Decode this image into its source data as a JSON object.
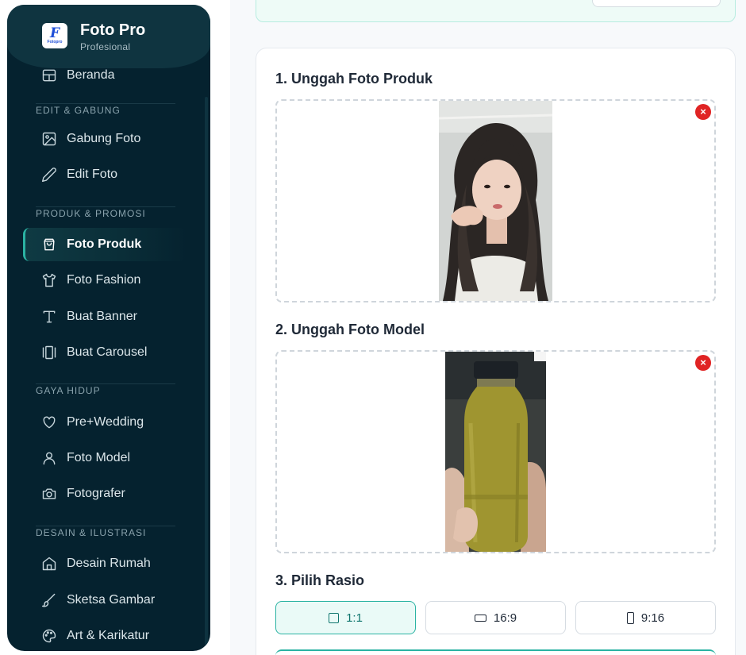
{
  "brand": {
    "title": "Foto Pro",
    "subtitle": "Profesional",
    "logo_letter": "F",
    "logo_text": "Fotopro"
  },
  "sidebar": {
    "partial_item": "Beranda",
    "sections": [
      {
        "label": "EDIT & GABUNG"
      },
      {
        "label": "PRODUK & PROMOSI"
      },
      {
        "label": "GAYA HIDUP"
      },
      {
        "label": "DESAIN & ILUSTRASI"
      }
    ],
    "items": [
      {
        "label": "Gabung Foto",
        "icon": "image-icon"
      },
      {
        "label": "Edit Foto",
        "icon": "pencil-icon"
      },
      {
        "label": "Foto Produk",
        "icon": "shopping-bag-icon",
        "active": true
      },
      {
        "label": "Foto Fashion",
        "icon": "shirt-icon"
      },
      {
        "label": "Buat Banner",
        "icon": "text-icon"
      },
      {
        "label": "Buat Carousel",
        "icon": "carousel-icon"
      },
      {
        "label": "Pre+Wedding",
        "icon": "heart-icon"
      },
      {
        "label": "Foto Model",
        "icon": "user-icon"
      },
      {
        "label": "Fotografer",
        "icon": "camera-icon"
      },
      {
        "label": "Desain Rumah",
        "icon": "home-icon"
      },
      {
        "label": "Sketsa Gambar",
        "icon": "brush-icon"
      },
      {
        "label": "Art & Karikatur",
        "icon": "palette-icon"
      }
    ]
  },
  "main": {
    "steps": [
      {
        "title": "1. Unggah Foto Produk",
        "remove": "×"
      },
      {
        "title": "2. Unggah Foto Model",
        "remove": "×"
      },
      {
        "title": "3. Pilih Rasio"
      }
    ],
    "ratios": [
      {
        "label": "1:1",
        "selected": true,
        "icon": "square-icon"
      },
      {
        "label": "16:9",
        "selected": false,
        "icon": "landscape-icon"
      },
      {
        "label": "9:16",
        "selected": false,
        "icon": "portrait-icon"
      }
    ]
  },
  "colors": {
    "sidebar_bg": "#05222f",
    "accent": "#2bb3a3",
    "remove": "#e02424"
  }
}
